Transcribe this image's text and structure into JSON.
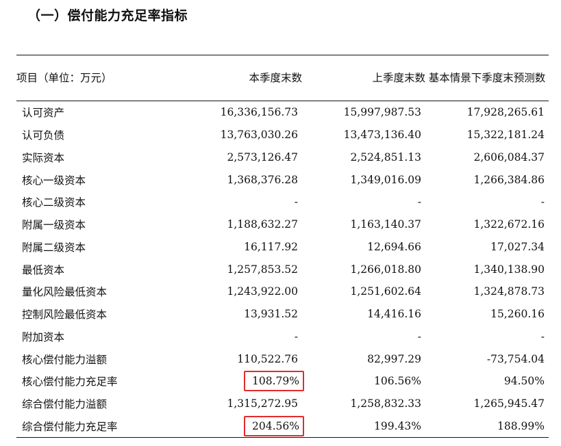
{
  "section_title": "（一）偿付能力充足率指标",
  "table": {
    "headers": {
      "item": "项目（单位：万元）",
      "current": "本季度末数",
      "previous": "上季度末数",
      "forecast": "基本情景下季度末预测数"
    },
    "rows": [
      {
        "item": "认可资产",
        "current": "16,336,156.73",
        "previous": "15,997,987.53",
        "forecast": "17,928,265.61"
      },
      {
        "item": "认可负债",
        "current": "13,763,030.26",
        "previous": "13,473,136.40",
        "forecast": "15,322,181.24"
      },
      {
        "item": "实际资本",
        "current": "2,573,126.47",
        "previous": "2,524,851.13",
        "forecast": "2,606,084.37"
      },
      {
        "item": "核心一级资本",
        "current": "1,368,376.28",
        "previous": "1,349,016.09",
        "forecast": "1,266,384.86"
      },
      {
        "item": "核心二级资本",
        "current": "-",
        "previous": "-",
        "forecast": "-"
      },
      {
        "item": "附属一级资本",
        "current": "1,188,632.27",
        "previous": "1,163,140.37",
        "forecast": "1,322,672.16"
      },
      {
        "item": "附属二级资本",
        "current": "16,117.92",
        "previous": "12,694.66",
        "forecast": "17,027.34"
      },
      {
        "item": "最低资本",
        "current": "1,257,853.52",
        "previous": "1,266,018.80",
        "forecast": "1,340,138.90"
      },
      {
        "item": "量化风险最低资本",
        "current": "1,243,922.00",
        "previous": "1,251,602.64",
        "forecast": "1,324,878.73"
      },
      {
        "item": "控制风险最低资本",
        "current": "13,931.52",
        "previous": "14,416.16",
        "forecast": "15,260.16"
      },
      {
        "item": "附加资本",
        "current": "-",
        "previous": "-",
        "forecast": "-"
      },
      {
        "item": "核心偿付能力溢额",
        "current": "110,522.76",
        "previous": "82,997.29",
        "forecast": "-73,754.04"
      },
      {
        "item": "核心偿付能力充足率",
        "current": "108.79%",
        "previous": "106.56%",
        "forecast": "94.50%"
      },
      {
        "item": "综合偿付能力溢额",
        "current": "1,315,272.95",
        "previous": "1,258,832.33",
        "forecast": "1,265,945.47"
      },
      {
        "item": "综合偿付能力充足率",
        "current": "204.56%",
        "previous": "199.43%",
        "forecast": "188.99%"
      }
    ]
  },
  "highlight_color": "#e22b2b"
}
